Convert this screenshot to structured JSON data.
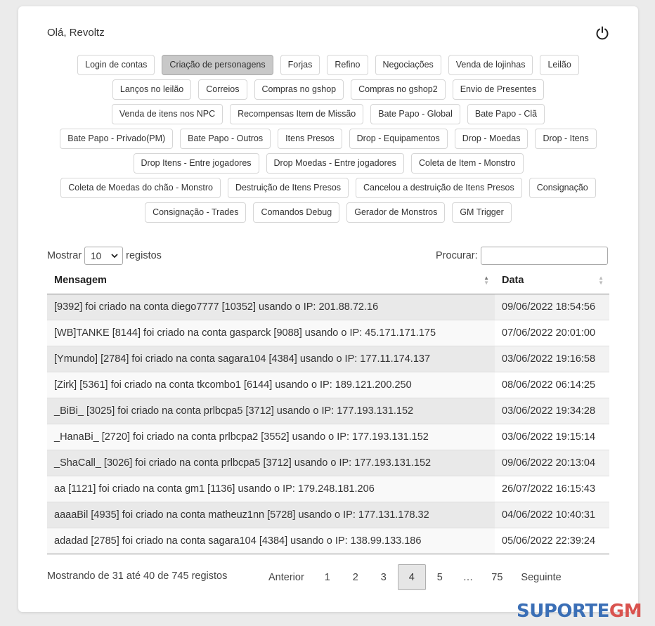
{
  "header": {
    "greeting": "Olá, Revoltz",
    "logout_icon": "power-icon"
  },
  "tags": [
    {
      "label": "Login de contas",
      "active": false
    },
    {
      "label": "Criação de personagens",
      "active": true
    },
    {
      "label": "Forjas",
      "active": false
    },
    {
      "label": "Refino",
      "active": false
    },
    {
      "label": "Negociações",
      "active": false
    },
    {
      "label": "Venda de lojinhas",
      "active": false
    },
    {
      "label": "Leilão",
      "active": false
    },
    {
      "label": "Lanços no leilão",
      "active": false
    },
    {
      "label": "Correios",
      "active": false
    },
    {
      "label": "Compras no gshop",
      "active": false
    },
    {
      "label": "Compras no gshop2",
      "active": false
    },
    {
      "label": "Envio de Presentes",
      "active": false
    },
    {
      "label": "Venda de itens nos NPC",
      "active": false
    },
    {
      "label": "Recompensas Item de Missão",
      "active": false
    },
    {
      "label": "Bate Papo - Global",
      "active": false
    },
    {
      "label": "Bate Papo - Clã",
      "active": false
    },
    {
      "label": "Bate Papo - Privado(PM)",
      "active": false
    },
    {
      "label": "Bate Papo - Outros",
      "active": false
    },
    {
      "label": "Itens Presos",
      "active": false
    },
    {
      "label": "Drop - Equipamentos",
      "active": false
    },
    {
      "label": "Drop - Moedas",
      "active": false
    },
    {
      "label": "Drop - Itens",
      "active": false
    },
    {
      "label": "Drop Itens - Entre jogadores",
      "active": false
    },
    {
      "label": "Drop Moedas - Entre jogadores",
      "active": false
    },
    {
      "label": "Coleta de Item - Monstro",
      "active": false
    },
    {
      "label": "Coleta de Moedas do chão - Monstro",
      "active": false
    },
    {
      "label": "Destruição de Itens Presos",
      "active": false
    },
    {
      "label": "Cancelou a destruição de Itens Presos",
      "active": false
    },
    {
      "label": "Consignação",
      "active": false
    },
    {
      "label": "Consignação - Trades",
      "active": false
    },
    {
      "label": "Comandos Debug",
      "active": false
    },
    {
      "label": "Gerador de Monstros",
      "active": false
    },
    {
      "label": "GM Trigger",
      "active": false
    }
  ],
  "length_control": {
    "prefix": "Mostrar",
    "value": "10",
    "suffix": "registos"
  },
  "search": {
    "label": "Procurar:",
    "value": ""
  },
  "table": {
    "columns": [
      "Mensagem",
      "Data"
    ],
    "rows": [
      {
        "message": "[9392] foi criado na conta diego7777 [10352] usando o IP: 201.88.72.16",
        "date": "09/06/2022 18:54:56"
      },
      {
        "message": "[WB]TANKE [8144] foi criado na conta gasparck [9088] usando o IP: 45.171.171.175",
        "date": "07/06/2022 20:01:00"
      },
      {
        "message": "[Ymundo] [2784] foi criado na conta sagara104 [4384] usando o IP: 177.11.174.137",
        "date": "03/06/2022 19:16:58"
      },
      {
        "message": "[Zirk] [5361] foi criado na conta tkcombo1 [6144] usando o IP: 189.121.200.250",
        "date": "08/06/2022 06:14:25"
      },
      {
        "message": "_BiBi_ [3025] foi criado na conta prlbcpa5 [3712] usando o IP: 177.193.131.152",
        "date": "03/06/2022 19:34:28"
      },
      {
        "message": "_HanaBi_ [2720] foi criado na conta prlbcpa2 [3552] usando o IP: 177.193.131.152",
        "date": "03/06/2022 19:15:14"
      },
      {
        "message": "_ShaCall_ [3026] foi criado na conta prlbcpa5 [3712] usando o IP: 177.193.131.152",
        "date": "09/06/2022 20:13:04"
      },
      {
        "message": "aa [1121] foi criado na conta gm1 [1136] usando o IP: 179.248.181.206",
        "date": "26/07/2022 16:15:43"
      },
      {
        "message": "aaaaBil [4935] foi criado na conta matheuz1nn [5728] usando o IP: 177.131.178.32",
        "date": "04/06/2022 10:40:31"
      },
      {
        "message": "adadad [2785] foi criado na conta sagara104 [4384] usando o IP: 138.99.133.186",
        "date": "05/06/2022 22:39:24"
      }
    ]
  },
  "info": "Mostrando de 31 até 40 de 745 registos",
  "pagination": {
    "prev": "Anterior",
    "pages": [
      "1",
      "2",
      "3",
      "4",
      "5",
      "…",
      "75"
    ],
    "current": "4",
    "next": "Seguinte"
  },
  "watermark": {
    "main": "SUPORTE",
    "accent": "GM"
  },
  "colors": {
    "active_tag": "#c8c8c8",
    "watermark_blue": "#3b6fb6",
    "watermark_red": "#d9534f"
  }
}
